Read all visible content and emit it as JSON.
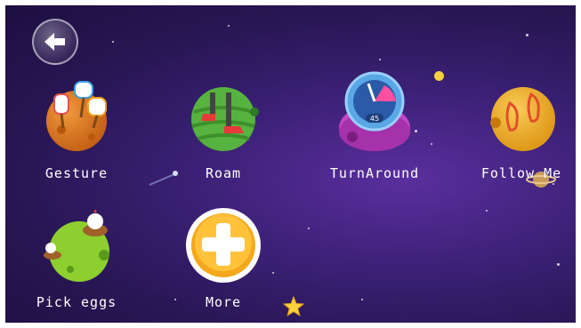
{
  "nav": {
    "back_icon": "back-arrow-icon"
  },
  "apps": [
    {
      "label": "Gesture",
      "icon": "hand-gesture-icon",
      "planet_color": "#e07a1f"
    },
    {
      "label": "Roam",
      "icon": "walking-legs-icon",
      "planet_color": "#56b33f"
    },
    {
      "label": "TurnAround",
      "icon": "compass-gauge-icon",
      "planet_color": "#c447c9"
    },
    {
      "label": "Follow Me",
      "icon": "footprints-icon",
      "planet_color": "#f2b120"
    },
    {
      "label": "Pick eggs",
      "icon": "chicken-nest-icon",
      "planet_color": "#8ccf2e"
    },
    {
      "label": "More",
      "icon": "plus-icon",
      "planet_color": "#f5a81b"
    }
  ],
  "gauge_value": "45"
}
